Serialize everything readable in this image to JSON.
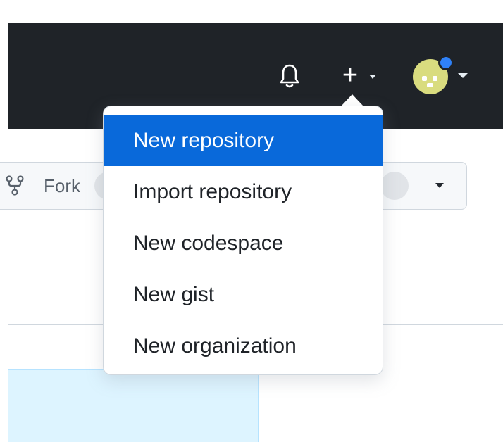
{
  "header": {
    "notifications_icon": "bell-icon",
    "create_icon": "plus-icon",
    "create_caret_icon": "caret-down-icon",
    "avatar_caret_icon": "caret-down-icon",
    "plus_glyph": "+"
  },
  "repo_actions": {
    "fork_label": "Fork",
    "fork_icon": "repo-forked-icon"
  },
  "create_menu": {
    "items": [
      {
        "label": "New repository",
        "active": true
      },
      {
        "label": "Import repository",
        "active": false
      },
      {
        "label": "New codespace",
        "active": false
      },
      {
        "label": "New gist",
        "active": false
      },
      {
        "label": "New organization",
        "active": false
      }
    ]
  },
  "colors": {
    "header_bg": "#1f2328",
    "accent": "#0969da",
    "avatar_badge": "#2f81f7"
  }
}
